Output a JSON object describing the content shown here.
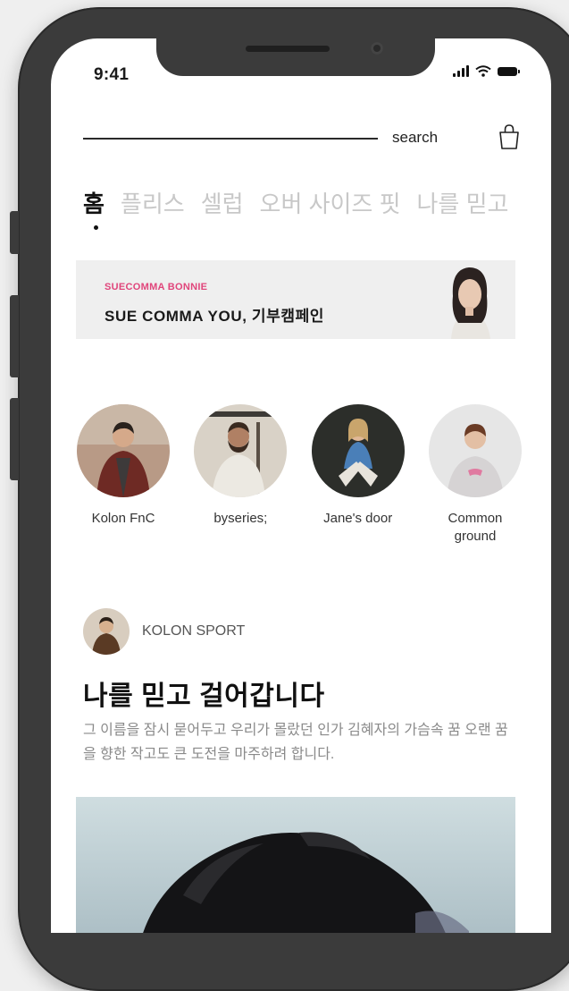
{
  "status_bar": {
    "time": "9:41"
  },
  "search": {
    "label": "search"
  },
  "tabs": [
    {
      "label": "홈",
      "active": true
    },
    {
      "label": "플리스",
      "active": false
    },
    {
      "label": "셀럽",
      "active": false
    },
    {
      "label": "오버 사이즈 핏",
      "active": false
    },
    {
      "label": "나를 믿고",
      "active": false
    }
  ],
  "banner": {
    "brand": "SUECOMMA BONNIE",
    "title": "SUE COMMA YOU, 기부캠페인"
  },
  "stories": [
    {
      "name": "Kolon FnC"
    },
    {
      "name": "byseries;"
    },
    {
      "name": "Jane's door"
    },
    {
      "name": "Common ground"
    }
  ],
  "feed": {
    "brand": "KOLON SPORT",
    "title": "나를 믿고 걸어갑니다",
    "description": "그 이름을 잠시 묻어두고 우리가 몰랐던 인가 김혜자의 가슴속 꿈 오랜 꿈을 향한 작고도 큰 도전을 마주하려 합니다."
  },
  "colors": {
    "accent": "#e0457b",
    "frame": "#3b3b3b",
    "banner_bg": "#efefef"
  }
}
